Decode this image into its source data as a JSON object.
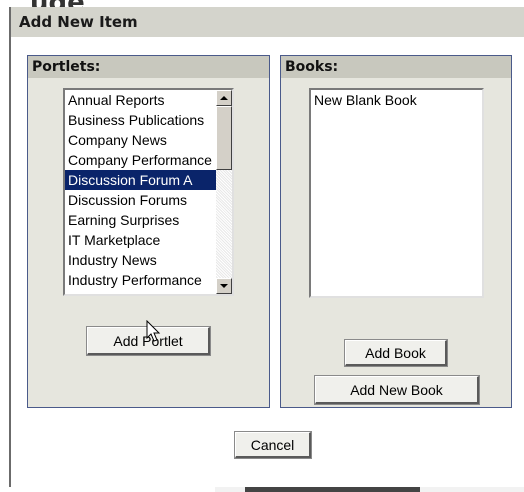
{
  "dialog": {
    "title": "Add New Item",
    "cancel_label": "Cancel"
  },
  "portlets": {
    "header": "Portlets:",
    "items": [
      "Annual Reports",
      "Business Publications",
      "Company News",
      "Company Performance",
      "Discussion Forum A",
      "Discussion Forums",
      "Earning Surprises",
      "IT Marketplace",
      "Industry News",
      "Industry Performance"
    ],
    "selected_index": 4,
    "add_label": "Add Portlet"
  },
  "books": {
    "header": "Books:",
    "items": [
      "New Blank Book"
    ],
    "add_label": "Add Book",
    "add_new_label": "Add New Book"
  },
  "background": {
    "title_fragment": "ude"
  },
  "colors": {
    "selection": "#0a246a",
    "title_bar": "#d4d4cc",
    "panel": "#e6e6de",
    "panel_border": "#4a5a8a"
  }
}
